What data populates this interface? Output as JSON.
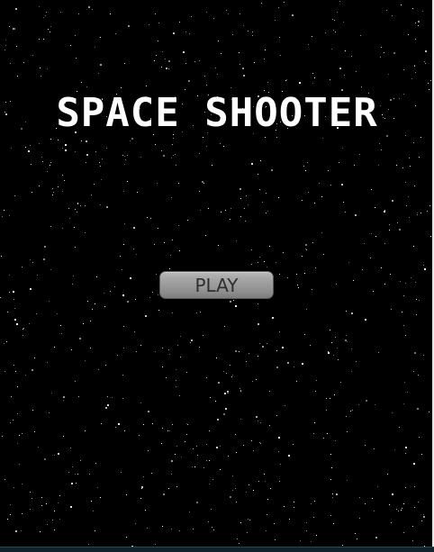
{
  "game": {
    "title": "SPACE SHOOTER",
    "play_label": "PLAY"
  },
  "colors": {
    "background": "#000000",
    "title": "#ffffff",
    "button_face": "#9b9b9b",
    "button_text": "#2f2f2f",
    "star": "#ffffff"
  }
}
